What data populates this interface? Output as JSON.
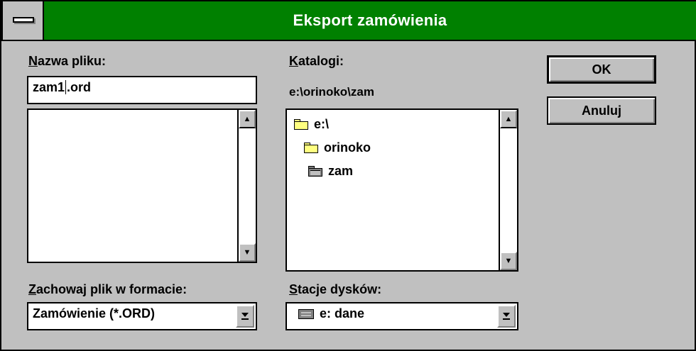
{
  "window": {
    "title": "Eksport zamówienia"
  },
  "filename": {
    "label_accel": "N",
    "label_rest": "azwa pliku:",
    "value_before_caret": "zam1",
    "value_after_caret": ".ord",
    "files": []
  },
  "directories": {
    "label_accel": "K",
    "label_rest": "atalogi:",
    "current_path": "e:\\orinoko\\zam",
    "items": [
      {
        "name": "e:\\",
        "icon": "open-folder-icon"
      },
      {
        "name": "orinoko",
        "icon": "open-folder-icon"
      },
      {
        "name": "zam",
        "icon": "selected-folder-icon"
      }
    ]
  },
  "save_format": {
    "label_accel": "Z",
    "label_rest": "achowaj plik w formacie:",
    "selected": "Zamówienie (*.ORD)"
  },
  "drives": {
    "label_accel": "S",
    "label_rest": "tacje dysków:",
    "selected": "e: dane",
    "icon": "hard-drive-icon"
  },
  "buttons": {
    "ok": "OK",
    "cancel": "Anuluj"
  },
  "colors": {
    "titlebar": "#008000",
    "face": "#c0c0c0",
    "folder": "#ffff80"
  }
}
